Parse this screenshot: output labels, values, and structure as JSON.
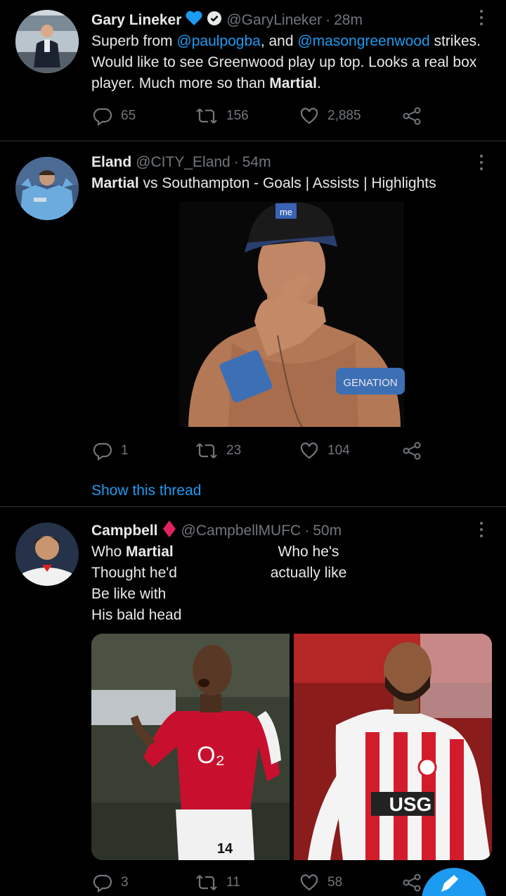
{
  "tweets": [
    {
      "name": "Gary Lineker",
      "handle": "@GaryLineker",
      "separator": "·",
      "time": "28m",
      "text_parts": {
        "p1": "Superb from ",
        "m1": "@paulpogba",
        "p2": ", and ",
        "m2": "@masongreenwood",
        "p3": " strikes. Would like to see Greenwood play up top. Looks a real box player. Much more so than ",
        "b1": "Martial",
        "p4": "."
      },
      "replies": "65",
      "retweets": "156",
      "likes": "2,885"
    },
    {
      "name": "Eland",
      "handle": "@CITY_Eland",
      "separator": "·",
      "time": "54m",
      "text_parts": {
        "b1": "Martial",
        "p1": " vs Southampton - Goals | Assists | Highlights"
      },
      "media_caps_text": "GENATION",
      "media_hat_text": "me",
      "replies": "1",
      "retweets": "23",
      "likes": "104",
      "show_thread": "Show this thread"
    },
    {
      "name": "Campbell",
      "handle": "@CampbellMUFC",
      "separator": "·",
      "time": "50m",
      "left_lines": [
        "Who ",
        "Martial",
        "Thought he'd",
        "Be like with",
        "His bald head"
      ],
      "right_lines": [
        "Who he's",
        "actually like"
      ],
      "media_left_jersey": "O₂",
      "media_left_number": "14",
      "media_right_sponsor": "USG",
      "replies": "3",
      "retweets": "11",
      "likes": "58"
    }
  ],
  "colors": {
    "background": "#000000",
    "text": "#e7e9ea",
    "muted": "#71767b",
    "accent": "#1d9bf0",
    "divider": "#2f3336",
    "diamond": "#e0245e"
  },
  "icons": [
    "reply-icon",
    "retweet-icon",
    "like-icon",
    "share-icon",
    "more-icon",
    "verified-icon",
    "blue-heart-icon",
    "red-diamond-icon"
  ]
}
